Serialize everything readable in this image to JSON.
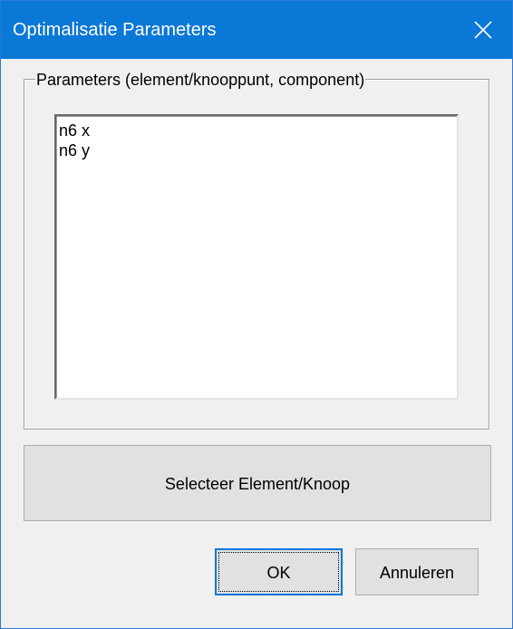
{
  "window": {
    "title": "Optimalisatie Parameters"
  },
  "group": {
    "legend": "Parameters (element/knooppunt, component)",
    "items": [
      "n6 x",
      "n6 y"
    ]
  },
  "buttons": {
    "select_label": "Selecteer Element/Knoop",
    "ok_label": "OK",
    "cancel_label": "Annuleren"
  },
  "icons": {
    "close": "close-icon"
  },
  "colors": {
    "titlebar": "#0a78d7",
    "dialog_bg": "#f0f0f0",
    "button_bg": "#e1e1e1",
    "default_button_border": "#0078d7"
  }
}
